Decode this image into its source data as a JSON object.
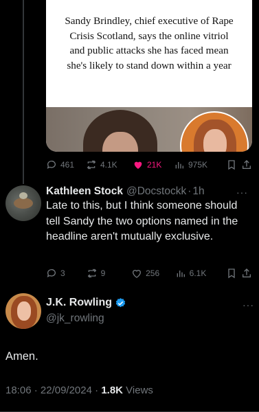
{
  "media": {
    "caption": "Sandy Brindley, chief executive of Rape Crisis Scotland, says the online vitriol and public attacks she has faced mean she's likely to stand down within a year"
  },
  "top_actions": {
    "replies": "461",
    "reposts": "4.1K",
    "likes": "21K",
    "views": "975K",
    "like_color": "#f91880"
  },
  "reply": {
    "name": "Kathleen Stock",
    "handle": "@Docstockk",
    "separator": "·",
    "time": "1h",
    "more": "···",
    "text": "Late to this, but I think someone should tell Sandy the two options named in the headline aren't mutually exclusive.",
    "actions": {
      "replies": "3",
      "reposts": "9",
      "likes": "256",
      "views": "6.1K"
    }
  },
  "main": {
    "name": "J.K. Rowling",
    "handle": "@jk_rowling",
    "more": "···",
    "text": "Amen.",
    "time": "18:06",
    "sep1": "·",
    "date": "22/09/2024",
    "sep2": "·",
    "views_count": "1.8K",
    "views_label": "Views",
    "verified_color": "#1d9bf0"
  },
  "icons": {
    "reply": "reply-icon",
    "repost": "repost-icon",
    "like": "heart-icon",
    "views": "views-icon",
    "bookmark": "bookmark-icon",
    "share": "share-icon",
    "verified": "verified-badge-icon"
  }
}
